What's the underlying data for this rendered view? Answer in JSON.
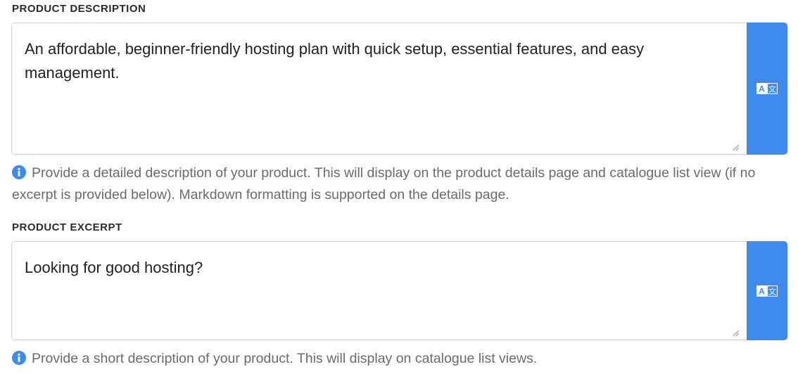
{
  "description": {
    "label": "PRODUCT DESCRIPTION",
    "value": "An affordable, beginner-friendly hosting plan with quick setup, essential features, and easy management.",
    "translate_icon": "translate-icon",
    "help_text": "Provide a detailed description of your product. This will display on the product details page and catalogue list view (if no excerpt is provided below). Markdown formatting is supported on the details page."
  },
  "excerpt": {
    "label": "PRODUCT EXCERPT",
    "value": "Looking for good hosting?",
    "translate_icon": "translate-icon",
    "help_text": "Provide a short description of your product. This will display on catalogue list views."
  },
  "colors": {
    "accent": "#3d8bef",
    "help_text": "#6b6b6b",
    "border": "#cfcfcf"
  }
}
